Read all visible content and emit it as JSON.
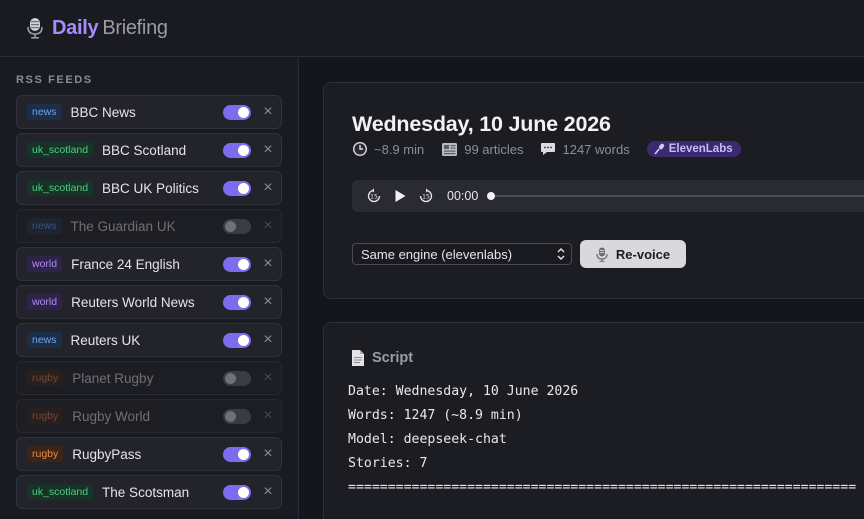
{
  "app": {
    "title_primary": "Daily",
    "title_secondary": "Briefing",
    "logo_icon": "microphone-icon"
  },
  "sidebar": {
    "title": "RSS FEEDS",
    "feeds": [
      {
        "tag": "news",
        "name": "BBC News",
        "enabled": true
      },
      {
        "tag": "uk_scotland",
        "name": "BBC Scotland",
        "enabled": true
      },
      {
        "tag": "uk_scotland",
        "name": "BBC UK Politics",
        "enabled": true
      },
      {
        "tag": "news",
        "name": "The Guardian UK",
        "enabled": false
      },
      {
        "tag": "world",
        "name": "France 24 English",
        "enabled": true
      },
      {
        "tag": "world",
        "name": "Reuters World News",
        "enabled": true
      },
      {
        "tag": "news",
        "name": "Reuters UK",
        "enabled": true
      },
      {
        "tag": "rugby",
        "name": "Planet Rugby",
        "enabled": false
      },
      {
        "tag": "rugby",
        "name": "Rugby World",
        "enabled": false
      },
      {
        "tag": "rugby",
        "name": "RugbyPass",
        "enabled": true
      },
      {
        "tag": "uk_scotland",
        "name": "The Scotsman",
        "enabled": true
      }
    ],
    "remove_glyph": "×"
  },
  "briefing": {
    "title": "Wednesday, 10 June 2026",
    "duration": "~8.9 min",
    "articles": "99 articles",
    "words": "1247 words",
    "engine_badge": "ElevenLabs",
    "player": {
      "time": "00:00",
      "progress": 0
    },
    "engine_select": "Same engine (elevenlabs)",
    "revoice_label": "Re-voice"
  },
  "script": {
    "title": "Script",
    "lines": [
      "Date: Wednesday, 10 June 2026",
      "Words: 1247 (~8.9 min)",
      "Model: deepseek-chat",
      "Stories: 7",
      "================================================================"
    ]
  },
  "colors": {
    "accent": "#a78bfa",
    "toggle_on": "#7c6cf0",
    "background": "#15161b"
  }
}
